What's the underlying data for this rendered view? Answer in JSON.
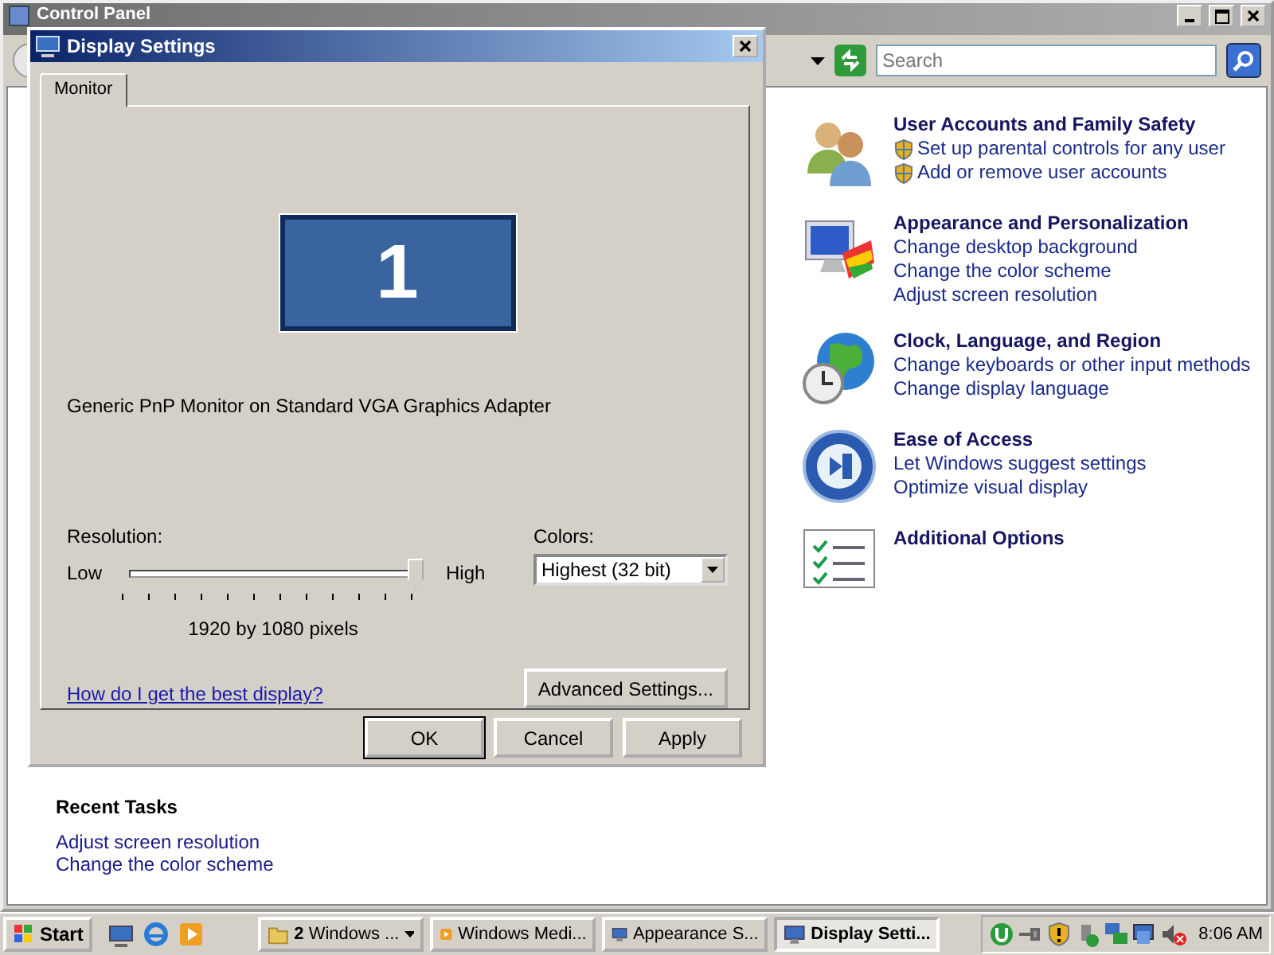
{
  "background_window": {
    "title": "Control Panel",
    "search": {
      "placeholder": "Search"
    },
    "categories": [
      {
        "kind": "users",
        "title": "User Accounts and Family Safety",
        "links": [
          {
            "text": "Set up parental controls for any user",
            "shield": true
          },
          {
            "text": "Add or remove user accounts",
            "shield": true
          }
        ]
      },
      {
        "kind": "appearance",
        "title": "Appearance and Personalization",
        "links": [
          {
            "text": "Change desktop background",
            "shield": false
          },
          {
            "text": "Change the color scheme",
            "shield": false
          },
          {
            "text": "Adjust screen resolution",
            "shield": false
          }
        ]
      },
      {
        "kind": "clock",
        "title": "Clock, Language, and Region",
        "links": [
          {
            "text": "Change keyboards or other input methods",
            "shield": false
          },
          {
            "text": "Change display language",
            "shield": false
          }
        ]
      },
      {
        "kind": "access",
        "title": "Ease of Access",
        "links": [
          {
            "text": "Let Windows suggest settings",
            "shield": false
          },
          {
            "text": "Optimize visual display",
            "shield": false
          }
        ]
      },
      {
        "kind": "options",
        "title": "Additional Options"
      }
    ],
    "recent_tasks": {
      "heading": "Recent Tasks",
      "items": [
        "Adjust screen resolution",
        "Change the color scheme"
      ]
    }
  },
  "dialog": {
    "title": "Display Settings",
    "tabs": [
      {
        "label": "Monitor",
        "selected": true
      }
    ],
    "monitor_number": "1",
    "monitor_name": "Generic PnP Monitor on Standard VGA Graphics Adapter",
    "resolution": {
      "label": "Resolution:",
      "low": "Low",
      "high": "High",
      "level": 1,
      "reading": "1920 by 1080 pixels"
    },
    "colors": {
      "label": "Colors:",
      "value": "Highest (32 bit)"
    },
    "help_link": "How do I get the best display?",
    "advanced_button": "Advanced Settings...",
    "buttons": [
      {
        "label": "OK",
        "default": true
      },
      {
        "label": "Cancel",
        "default": false
      },
      {
        "label": "Apply",
        "default": false
      }
    ]
  },
  "taskbar": {
    "start": "Start",
    "tasks": [
      {
        "label": "**2** Windows ...",
        "kind": "group",
        "selected": false
      },
      {
        "label": "Windows Medi...",
        "kind": "media",
        "selected": false
      },
      {
        "label": "Appearance S...",
        "kind": "display",
        "selected": false
      },
      {
        "label": "Display Setti...",
        "kind": "display",
        "selected": true
      }
    ],
    "clock": "8:06 AM"
  }
}
